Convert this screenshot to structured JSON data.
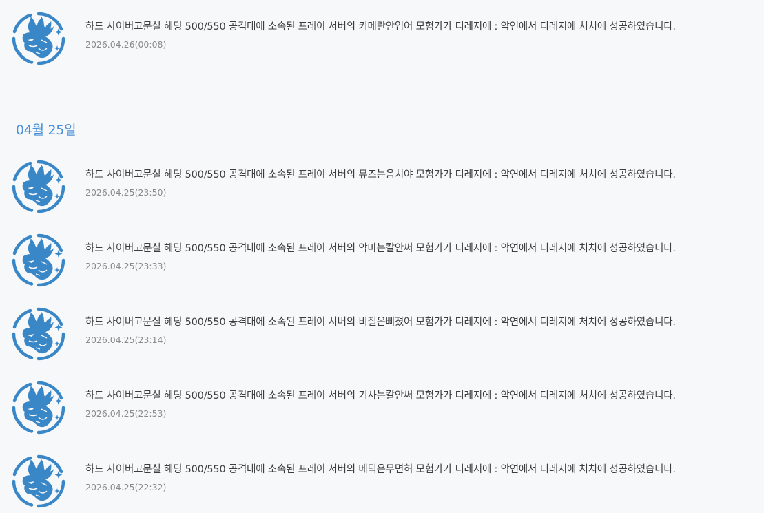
{
  "date_header": "04월 25일",
  "entries": [
    {
      "message": "하드 사이버고문실 헤딩 500/550 공격대에 소속된 프레이 서버의 키메란안입어 모험가가 디레지에 : 악연에서 디레지에 처치에 성공하였습니다.",
      "time": "2026.04.26(00:08)"
    },
    {
      "message": "하드 사이버고문실 헤딩 500/550 공격대에 소속된 프레이 서버의 뮤즈는음치야 모험가가 디레지에 : 악연에서 디레지에 처치에 성공하였습니다.",
      "time": "2026.04.25(23:50)"
    },
    {
      "message": "하드 사이버고문실 헤딩 500/550 공격대에 소속된 프레이 서버의 악마는칼안써 모험가가 디레지에 : 악연에서 디레지에 처치에 성공하였습니다.",
      "time": "2026.04.25(23:33)"
    },
    {
      "message": "하드 사이버고문실 헤딩 500/550 공격대에 소속된 프레이 서버의 비질은삐졌어 모험가가 디레지에 : 악연에서 디레지에 처치에 성공하였습니다.",
      "time": "2026.04.25(23:14)"
    },
    {
      "message": "하드 사이버고문실 헤딩 500/550 공격대에 소속된 프레이 서버의 기사는칼안써 모험가가 디레지에 : 악연에서 디레지에 처치에 성공하였습니다.",
      "time": "2026.04.25(22:53)"
    },
    {
      "message": "하드 사이버고문실 헤딩 500/550 공격대에 소속된 프레이 서버의 메딕은무면허 모험가가 디레지에 : 악연에서 디레지에 처치에 성공하였습니다.",
      "time": "2026.04.25(22:32)"
    }
  ],
  "colors": {
    "accent": "#3a87c8",
    "date_header": "#4a90d9",
    "message_text": "#3d3d3d",
    "time_text": "#8a8a8a",
    "background": "#f7f8fa"
  },
  "icon": "raid-boss-emblem-icon"
}
